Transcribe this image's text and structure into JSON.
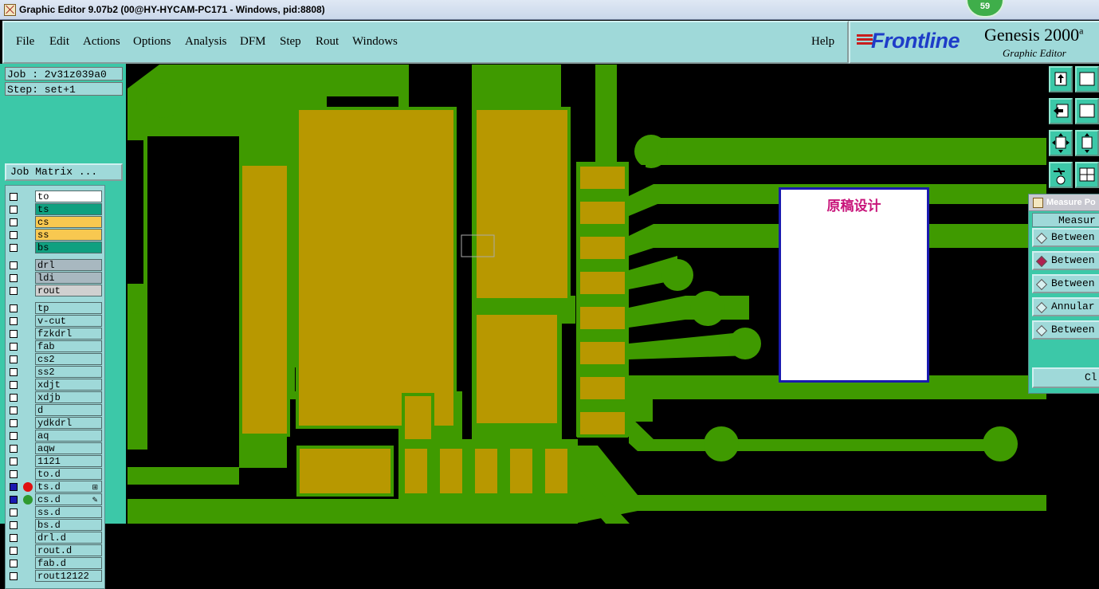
{
  "window": {
    "title": "Graphic Editor 9.07b2 (00@HY-HYCAM-PC171 - Windows, pid:8808)",
    "badge": "59"
  },
  "menu": [
    "File",
    "Edit",
    "Actions",
    "Options",
    "Analysis",
    "DFM",
    "Step",
    "Rout",
    "Windows"
  ],
  "help_label": "Help",
  "brand": {
    "logo": "Frontline",
    "product": "Genesis 2000",
    "subtitle": "Graphic Editor",
    "product_suffix": "a"
  },
  "job": {
    "job_label": "Job : 2v31z039a0",
    "step_label": "Step: set+1",
    "matrix_button": "Job Matrix ..."
  },
  "layers": [
    {
      "name": "to",
      "color": "#ffffff"
    },
    {
      "name": "ts",
      "color": "#10a080"
    },
    {
      "name": "cs",
      "color": "#f8c850"
    },
    {
      "name": "ss",
      "color": "#f8c850"
    },
    {
      "name": "bs",
      "color": "#10a080"
    },
    {
      "name": "drl",
      "color": "#a8b8c0"
    },
    {
      "name": "ldi",
      "color": "#a8b8c0"
    },
    {
      "name": "rout",
      "color": "#d0d0d0"
    },
    {
      "name": "tp",
      "color": "#9fd9d9"
    },
    {
      "name": "v-cut",
      "color": "#9fd9d9"
    },
    {
      "name": "fzkdrl",
      "color": "#9fd9d9"
    },
    {
      "name": "fab",
      "color": "#9fd9d9"
    },
    {
      "name": "cs2",
      "color": "#9fd9d9"
    },
    {
      "name": "ss2",
      "color": "#9fd9d9"
    },
    {
      "name": "xdjt",
      "color": "#9fd9d9"
    },
    {
      "name": "xdjb",
      "color": "#9fd9d9"
    },
    {
      "name": "d",
      "color": "#9fd9d9"
    },
    {
      "name": "ydkdrl",
      "color": "#9fd9d9"
    },
    {
      "name": "aq",
      "color": "#9fd9d9"
    },
    {
      "name": "aqw",
      "color": "#9fd9d9"
    },
    {
      "name": "1121",
      "color": "#9fd9d9"
    },
    {
      "name": "to.d",
      "color": "#9fd9d9"
    },
    {
      "name": "ts.d",
      "color": "#9fd9d9",
      "active_color": "#e01010",
      "tag": "⊞"
    },
    {
      "name": "cs.d",
      "color": "#9fd9d9",
      "active_color": "#2f9a2f",
      "tag": "✎"
    },
    {
      "name": "ss.d",
      "color": "#9fd9d9"
    },
    {
      "name": "bs.d",
      "color": "#9fd9d9"
    },
    {
      "name": "drl.d",
      "color": "#9fd9d9"
    },
    {
      "name": "rout.d",
      "color": "#9fd9d9"
    },
    {
      "name": "fab.d",
      "color": "#9fd9d9"
    },
    {
      "name": "rout12122",
      "color": "#9fd9d9"
    }
  ],
  "measure": {
    "title": "Measure Po",
    "section": "Measur",
    "options": [
      {
        "label": "Between",
        "selected": false
      },
      {
        "label": "Between",
        "selected": true
      },
      {
        "label": "Between",
        "selected": false
      },
      {
        "label": "Annular",
        "selected": false
      },
      {
        "label": "Between",
        "selected": false
      }
    ],
    "close_label": "Cl"
  },
  "canvas_note": "原稿设计",
  "colors": {
    "copper": "#3f9a00",
    "pad": "#b89800",
    "background": "#000000",
    "panel": "#9fd9d9",
    "accent": "#3cc8a8"
  }
}
